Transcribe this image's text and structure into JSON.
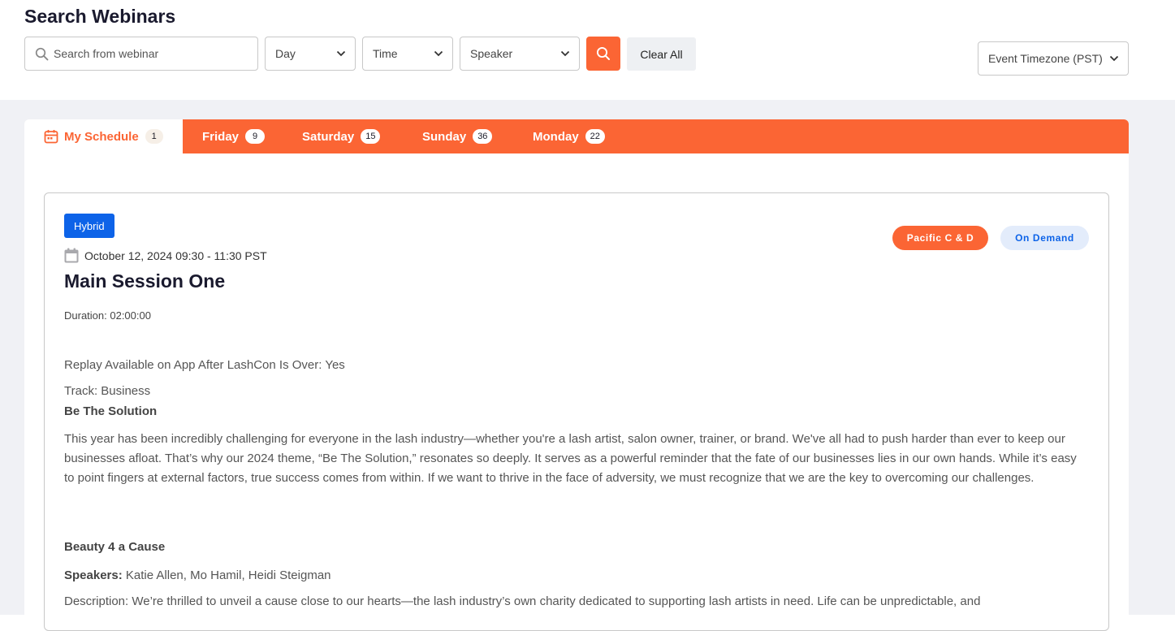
{
  "header": {
    "title": "Search Webinars",
    "search_placeholder": "Search from webinar",
    "day_label": "Day",
    "time_label": "Time",
    "speaker_label": "Speaker",
    "clear_label": "Clear All",
    "timezone_label": "Event Timezone (PST)"
  },
  "tabs": [
    {
      "label": "My Schedule",
      "count": "1"
    },
    {
      "label": "Friday",
      "count": "9"
    },
    {
      "label": "Saturday",
      "count": "15"
    },
    {
      "label": "Sunday",
      "count": "36"
    },
    {
      "label": "Monday",
      "count": "22"
    }
  ],
  "session": {
    "type_badge": "Hybrid",
    "room": "Pacific C & D",
    "availability": "On Demand",
    "datetime": "October 12, 2024 09:30 - 11:30 PST",
    "title": "Main Session One",
    "duration": "Duration: 02:00:00",
    "replay": "Replay Available on App After LashCon Is Over: Yes",
    "track": "Track: Business",
    "section1_heading": "Be The Solution",
    "section1_text": "This year has been incredibly challenging for everyone in the lash industry—whether you're a lash artist, salon owner, trainer, or brand. We've all had to push harder than ever to keep our businesses afloat. That’s why our 2024 theme, “Be The Solution,” resonates so deeply. It serves as a powerful reminder that the fate of our businesses lies in our own hands. While it’s easy to point fingers at external factors, true success comes from within. If we want to thrive in the face of adversity, we must recognize that we are the key to overcoming our challenges.",
    "section2_heading": "Beauty 4 a Cause",
    "speakers_label": "Speakers:",
    "speakers_value": "Katie Allen, Mo Hamil, Heidi Steigman",
    "description": "Description: We’re thrilled to unveil a cause close to our hearts—the lash industry’s own charity dedicated to supporting lash artists in need. Life can be unpredictable, and"
  },
  "colors": {
    "accent": "#fb6534",
    "blue": "#0d63e8",
    "bg": "#f0f1f5"
  }
}
